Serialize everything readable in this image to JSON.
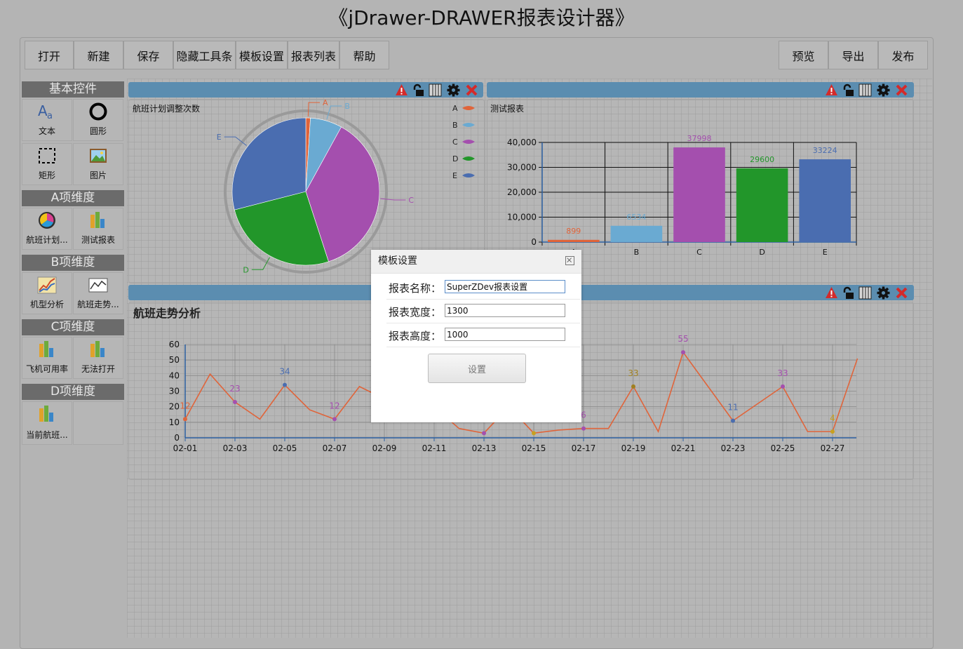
{
  "title": "《jDrawer-DRAWER报表设计器》",
  "toolbar": {
    "left": [
      "打开",
      "新建",
      "保存",
      "隐藏工具条",
      "模板设置",
      "报表列表",
      "帮助"
    ],
    "right": [
      "预览",
      "导出",
      "发布"
    ]
  },
  "palette": {
    "groups": [
      {
        "title": "基本控件",
        "items": [
          {
            "label": "文本",
            "icon": "text-icon"
          },
          {
            "label": "圆形",
            "icon": "circle-icon"
          },
          {
            "label": "矩形",
            "icon": "rectangle-icon"
          },
          {
            "label": "图片",
            "icon": "picture-icon"
          }
        ]
      },
      {
        "title": "A项维度",
        "items": [
          {
            "label": "航班计划...",
            "icon": "pie-chart-icon"
          },
          {
            "label": "测试报表",
            "icon": "bar-chart-icon"
          }
        ]
      },
      {
        "title": "B项维度",
        "items": [
          {
            "label": "机型分析",
            "icon": "line-chart-icon"
          },
          {
            "label": "航班走势...",
            "icon": "line-chart-icon"
          }
        ]
      },
      {
        "title": "C项维度",
        "items": [
          {
            "label": "飞机可用率",
            "icon": "bar-chart-icon"
          },
          {
            "label": "无法打开",
            "icon": "bar-chart-icon"
          }
        ]
      },
      {
        "title": "D项维度",
        "items": [
          {
            "label": "当前航班...",
            "icon": "bar-chart-icon"
          }
        ]
      }
    ]
  },
  "panel_controls": [
    "warning-icon",
    "unlock-icon",
    "columns-icon",
    "gear-icon",
    "close-icon"
  ],
  "colors": {
    "A": "#e0643a",
    "B": "#6aaad2",
    "C": "#a44fae",
    "D": "#22962a",
    "E": "#4a6db0",
    "panel_bar": "#5b8db0"
  },
  "chart_data": [
    {
      "type": "pie",
      "title": "航班计划调整次数",
      "categories": [
        "A",
        "B",
        "C",
        "D",
        "E"
      ],
      "values": [
        1,
        7,
        37,
        26,
        29
      ],
      "legend": "right"
    },
    {
      "type": "bar",
      "title": "测试报表",
      "categories": [
        "A",
        "B",
        "C",
        "D",
        "E"
      ],
      "values": [
        899,
        6534,
        37998,
        29600,
        33224
      ],
      "data_labels": [
        "899",
        "6534",
        "37998",
        "29600",
        "33224"
      ],
      "yticks": [
        "0",
        "10,000",
        "20,000",
        "30,000",
        "40,000"
      ],
      "ylim": [
        0,
        40000
      ],
      "grid": true
    },
    {
      "type": "line",
      "title": "航班走势分析",
      "x": [
        "02-01",
        "02-02",
        "02-03",
        "02-04",
        "02-05",
        "02-06",
        "02-07",
        "02-08",
        "02-09",
        "02-10",
        "02-11",
        "02-12",
        "02-13",
        "02-14",
        "02-15",
        "02-16",
        "02-17",
        "02-18",
        "02-19",
        "02-20",
        "02-21",
        "02-22",
        "02-23",
        "02-24",
        "02-25",
        "02-26",
        "02-27",
        "02-28"
      ],
      "values": [
        12,
        41,
        23,
        12,
        34,
        18,
        12,
        33,
        25,
        20,
        20,
        6,
        3,
        20,
        3,
        5,
        6,
        6,
        33,
        4,
        55,
        33,
        11,
        22,
        33,
        4,
        4,
        51
      ],
      "xticks": [
        "02-01",
        "02-03",
        "02-05",
        "02-07",
        "02-09",
        "02-11",
        "02-13",
        "02-15",
        "02-17",
        "02-19",
        "02-21",
        "02-23",
        "02-25",
        "02-27"
      ],
      "yticks": [
        "0",
        "10",
        "20",
        "30",
        "40",
        "50",
        "60"
      ],
      "ylim": [
        0,
        60
      ],
      "labeled_points": [
        {
          "x": "02-01",
          "value": 12,
          "label": "12"
        },
        {
          "x": "02-03",
          "value": 23,
          "label": "23"
        },
        {
          "x": "02-05",
          "value": 34,
          "label": "34"
        },
        {
          "x": "02-07",
          "value": 12,
          "label": "12"
        },
        {
          "x": "02-13",
          "value": 3,
          "label": ""
        },
        {
          "x": "02-15",
          "value": 3,
          "label": ""
        },
        {
          "x": "02-17",
          "value": 6,
          "label": "6"
        },
        {
          "x": "02-19",
          "value": 33,
          "label": "33"
        },
        {
          "x": "02-21",
          "value": 55,
          "label": "55"
        },
        {
          "x": "02-23",
          "value": 11,
          "label": "11"
        },
        {
          "x": "02-25",
          "value": 33,
          "label": "33"
        },
        {
          "x": "02-27",
          "value": 4,
          "label": "4"
        }
      ]
    }
  ],
  "modal": {
    "title": "模板设置",
    "fields": [
      {
        "label": "报表名称：",
        "value": "SuperZDev报表设置"
      },
      {
        "label": "报表宽度：",
        "value": "1300"
      },
      {
        "label": "报表高度：",
        "value": "1000"
      }
    ],
    "button": "设置"
  }
}
